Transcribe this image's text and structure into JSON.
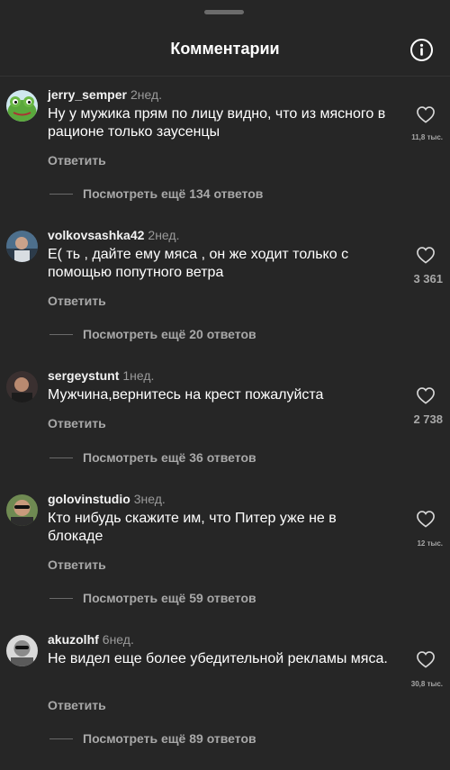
{
  "header": {
    "title": "Комментарии",
    "info_icon": "info-circle-icon"
  },
  "colors": {
    "background": "#262626",
    "text": "#ffffff",
    "secondary": "#a8a8a8"
  },
  "comments": [
    {
      "username": "jerry_semper",
      "time": "2нед.",
      "text": "Ну у мужика прям по лицу видно, что из мясного в рационе только заусенцы",
      "likes": "11,8 тыс.",
      "reply_label": "Ответить",
      "more_replies": "Посмотреть ещё 134 ответов",
      "avatar": "frog-avatar"
    },
    {
      "username": "volkovsashka42",
      "time": "2нед.",
      "text": "Е( ть , дайте ему мяса , он же ходит только с помощью попутного ветра",
      "likes": "3 361",
      "reply_label": "Ответить",
      "more_replies": "Посмотреть ещё 20 ответов",
      "avatar": "photo-avatar"
    },
    {
      "username": "sergeystunt",
      "time": "1нед.",
      "text": "Мужчина,вернитесь на крест пожалуйста",
      "likes": "2 738",
      "reply_label": "Ответить",
      "more_replies": "Посмотреть ещё 36 ответов",
      "avatar": "photo-avatar"
    },
    {
      "username": "golovinstudio",
      "time": "3нед.",
      "text": "Кто нибудь скажите им, что Питер уже не в блокаде",
      "likes": "12 тыс.",
      "reply_label": "Ответить",
      "more_replies": "Посмотреть ещё 59 ответов",
      "avatar": "photo-avatar"
    },
    {
      "username": "akuzolhf",
      "time": "6нед.",
      "text": "Не видел еще более убедительной рекламы мяса.",
      "likes": "30,8 тыс.",
      "reply_label": "Ответить",
      "more_replies": "Посмотреть ещё 89 ответов",
      "avatar": "photo-avatar"
    }
  ]
}
